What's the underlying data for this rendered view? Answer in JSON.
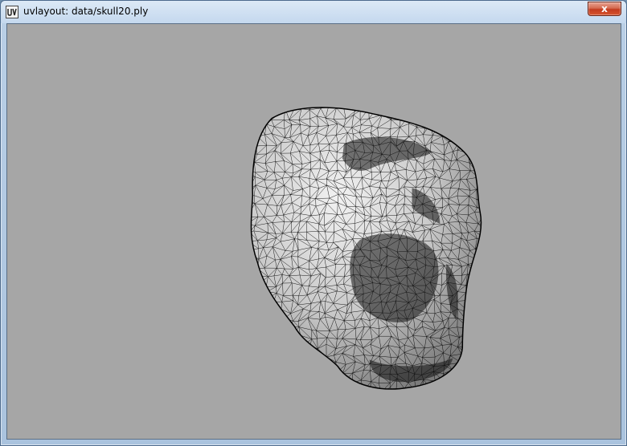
{
  "window": {
    "title": "uvlayout: data/skull20.ply",
    "app_icon": "uv-app-icon",
    "close_icon": "close-icon",
    "close_glyph": "x"
  },
  "viewport": {
    "background": "#a6a6a6",
    "model_name": "skull-wireframe",
    "model_fill": "#d0d0d0",
    "wire_color": "#000000"
  },
  "colors": {
    "titlebar": "#c4d8ee",
    "close_button": "#c23b1f"
  }
}
